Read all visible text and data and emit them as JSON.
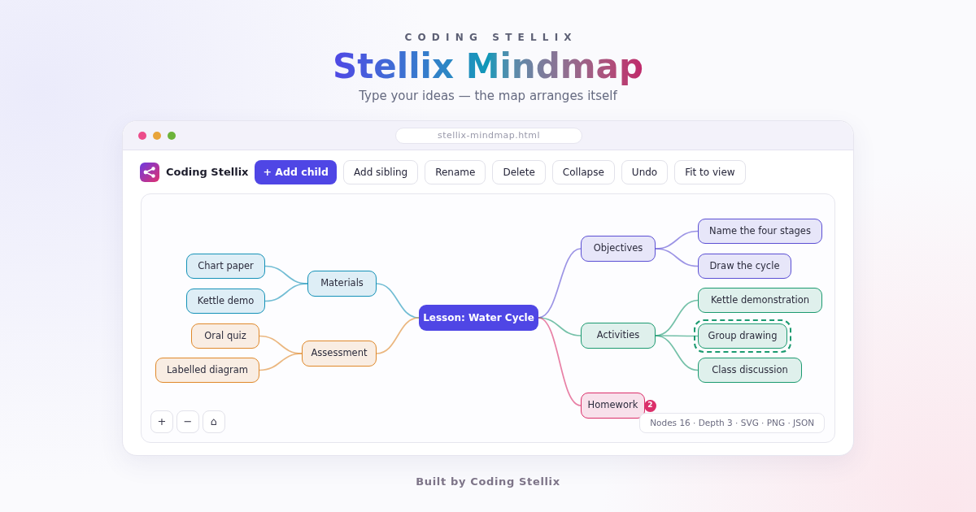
{
  "header": {
    "eyebrow": "CODING STELLIX",
    "title": "Stellix Mindmap",
    "subtitle": "Type your ideas — the map arranges itself"
  },
  "window": {
    "address": "stellix-mindmap.html",
    "brand": "Coding Stellix",
    "toolbar": [
      {
        "label": "+ Add child",
        "primary": true
      },
      {
        "label": "Add sibling",
        "primary": false
      },
      {
        "label": "Rename",
        "primary": false
      },
      {
        "label": "Delete",
        "primary": false
      },
      {
        "label": "Collapse",
        "primary": false
      },
      {
        "label": "Undo",
        "primary": false
      },
      {
        "label": "Fit to view",
        "primary": false
      }
    ],
    "mindmap": {
      "root": {
        "label": "Lesson: Water Cycle",
        "selected": false
      },
      "branches": [
        {
          "label": "Materials",
          "color": "#1592b8",
          "selected": false,
          "children": [
            {
              "label": "Chart paper",
              "selected": false
            },
            {
              "label": "Kettle demo",
              "selected": false
            }
          ]
        },
        {
          "label": "Assessment",
          "color": "#e0892b",
          "selected": false,
          "children": [
            {
              "label": "Oral quiz",
              "selected": false
            },
            {
              "label": "Labelled diagram",
              "selected": false
            }
          ]
        },
        {
          "label": "Objectives",
          "color": "#5b4fd4",
          "selected": false,
          "children": [
            {
              "label": "Name the four stages",
              "selected": false
            },
            {
              "label": "Draw the cycle",
              "selected": false
            }
          ]
        },
        {
          "label": "Activities",
          "color": "#1b9a70",
          "selected": false,
          "children": [
            {
              "label": "Kettle demonstration",
              "selected": false
            },
            {
              "label": "Group drawing",
              "selected": true
            },
            {
              "label": "Class discussion",
              "selected": false
            }
          ]
        },
        {
          "label": "Homework",
          "color": "#db2f6a",
          "selected": false,
          "badge": "2"
        }
      ]
    },
    "canvas_controls": [
      "+",
      "−",
      "⌂"
    ],
    "status": "Nodes 16 · Depth 3 · SVG · PNG · JSON"
  },
  "footer": "Built by Coding Stellix"
}
